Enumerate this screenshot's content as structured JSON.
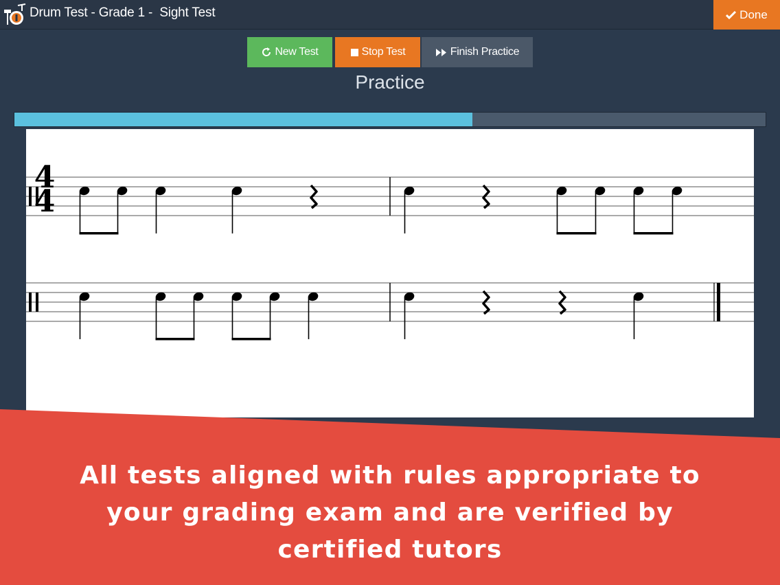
{
  "header": {
    "title": "Drum Test - Grade 1 -  Sight Test",
    "done_label": "Done"
  },
  "toolbar": {
    "new_test_label": "New Test",
    "stop_test_label": "Stop Test",
    "finish_practice_label": "Finish Practice"
  },
  "mode_title": "Practice",
  "progress": {
    "fraction": 0.61
  },
  "score": {
    "time_signature": {
      "top": "4",
      "bottom": "4"
    }
  },
  "banner": {
    "line1": "All tests aligned with rules appropriate to",
    "line2": "your grading exam and are verified by",
    "line3": "certified tutors"
  },
  "colors": {
    "accent_orange": "#e87722",
    "new_test_green": "#5cb85c",
    "progress_blue": "#5bc0de",
    "banner_red": "#e44c3f"
  }
}
